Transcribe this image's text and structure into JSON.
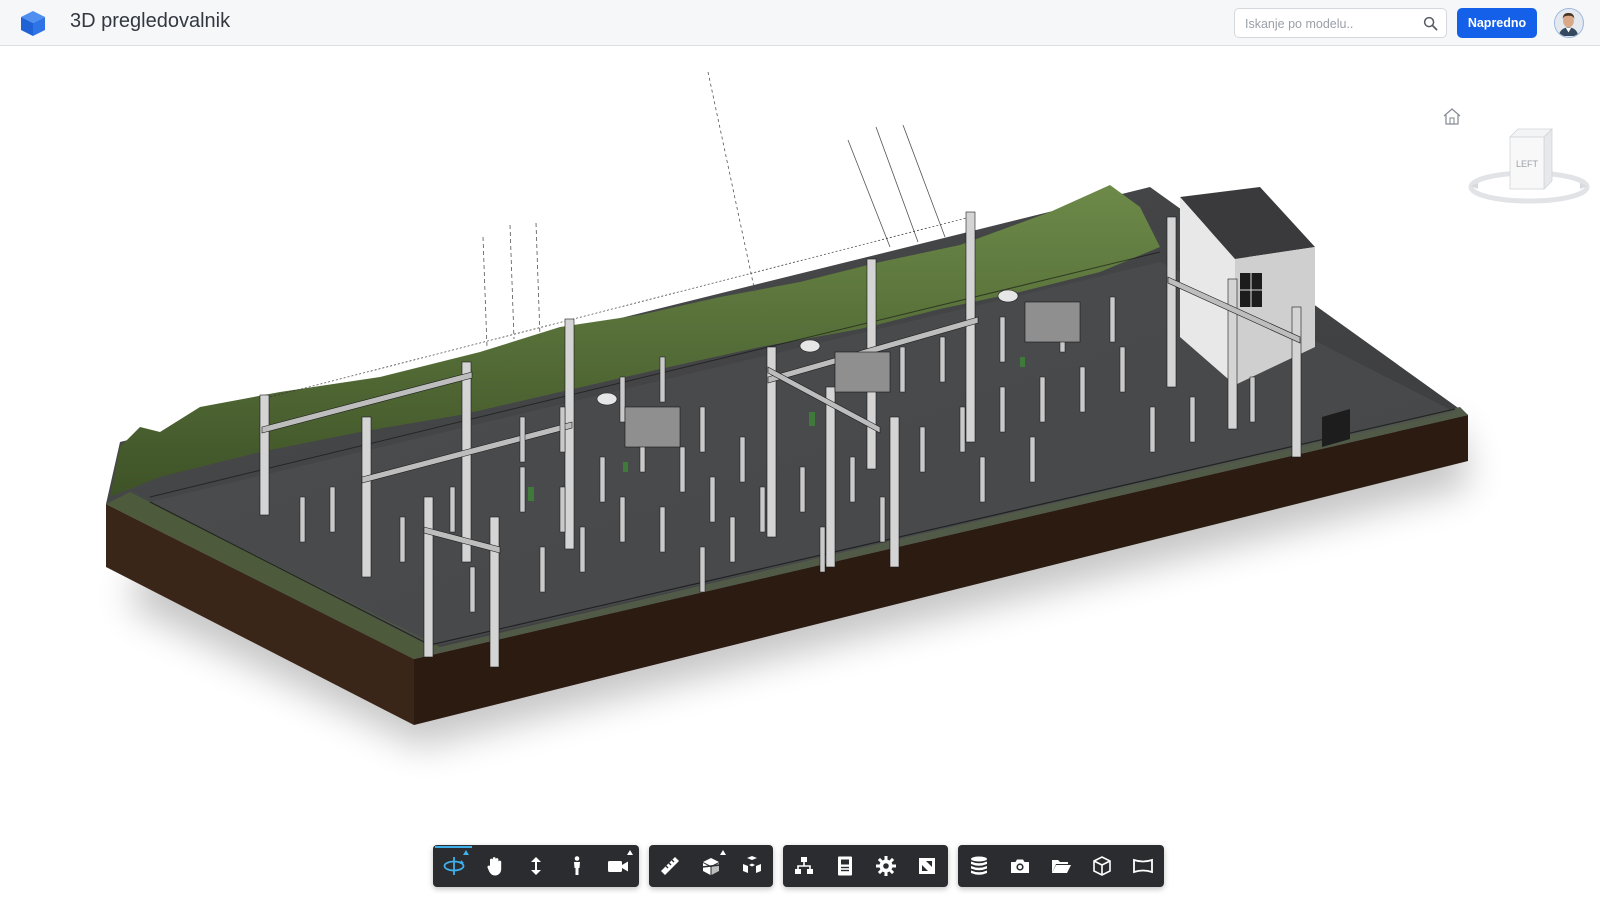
{
  "header": {
    "app_title": "3D pregledovalnik",
    "search": {
      "placeholder": "Iskanje po modelu..",
      "value": ""
    },
    "advanced_button": "Napredno",
    "accent_color": "#1560e8"
  },
  "viewport": {
    "viewcube_face": "LEFT",
    "home_icon": "home-icon"
  },
  "toolbar": {
    "groups": [
      {
        "tools": [
          "orbit-icon",
          "pan-icon",
          "zoom-icon",
          "first-person-icon",
          "camera-icon"
        ]
      },
      {
        "tools": [
          "measure-icon",
          "section-icon",
          "explode-icon"
        ]
      },
      {
        "tools": [
          "model-browser-icon",
          "properties-icon",
          "settings-icon",
          "fullscreen-icon"
        ]
      },
      {
        "tools": [
          "layers-icon",
          "screenshot-icon",
          "open-folder-icon",
          "model-icon",
          "sheets-icon"
        ]
      }
    ],
    "active_tool": "orbit-icon",
    "active_color": "#3fb0ea"
  }
}
